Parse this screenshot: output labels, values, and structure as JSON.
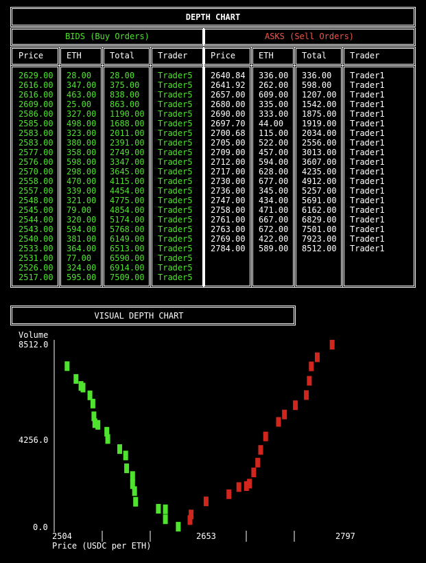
{
  "title": "DEPTH CHART",
  "bids_title": "BIDS (Buy Orders)",
  "asks_title": "ASKS (Sell Orders)",
  "columns": [
    "Price",
    "ETH",
    "Total",
    "Trader"
  ],
  "bids": [
    [
      "2629.00",
      "28.00",
      "28.00",
      "Trader5"
    ],
    [
      "2616.00",
      "347.00",
      "375.00",
      "Trader5"
    ],
    [
      "2616.00",
      "463.00",
      "838.00",
      "Trader5"
    ],
    [
      "2609.00",
      "25.00",
      "863.00",
      "Trader5"
    ],
    [
      "2586.00",
      "327.00",
      "1190.00",
      "Trader5"
    ],
    [
      "2585.00",
      "498.00",
      "1688.00",
      "Trader5"
    ],
    [
      "2583.00",
      "323.00",
      "2011.00",
      "Trader5"
    ],
    [
      "2583.00",
      "380.00",
      "2391.00",
      "Trader5"
    ],
    [
      "2577.00",
      "358.00",
      "2749.00",
      "Trader5"
    ],
    [
      "2576.00",
      "598.00",
      "3347.00",
      "Trader5"
    ],
    [
      "2570.00",
      "298.00",
      "3645.00",
      "Trader5"
    ],
    [
      "2558.00",
      "470.00",
      "4115.00",
      "Trader5"
    ],
    [
      "2557.00",
      "339.00",
      "4454.00",
      "Trader5"
    ],
    [
      "2548.00",
      "321.00",
      "4775.00",
      "Trader5"
    ],
    [
      "2545.00",
      "79.00",
      "4854.00",
      "Trader5"
    ],
    [
      "2544.00",
      "320.00",
      "5174.00",
      "Trader5"
    ],
    [
      "2543.00",
      "594.00",
      "5768.00",
      "Trader5"
    ],
    [
      "2540.00",
      "381.00",
      "6149.00",
      "Trader5"
    ],
    [
      "2533.00",
      "364.00",
      "6513.00",
      "Trader5"
    ],
    [
      "2531.00",
      "77.00",
      "6590.00",
      "Trader5"
    ],
    [
      "2526.00",
      "324.00",
      "6914.00",
      "Trader5"
    ],
    [
      "2517.00",
      "595.00",
      "7509.00",
      "Trader5"
    ]
  ],
  "asks": [
    [
      "2640.84",
      "336.00",
      "336.00",
      "Trader1"
    ],
    [
      "2641.92",
      "262.00",
      "598.00",
      "Trader1"
    ],
    [
      "2657.00",
      "609.00",
      "1207.00",
      "Trader1"
    ],
    [
      "2680.00",
      "335.00",
      "1542.00",
      "Trader1"
    ],
    [
      "2690.00",
      "333.00",
      "1875.00",
      "Trader1"
    ],
    [
      "2697.70",
      "44.00",
      "1919.00",
      "Trader1"
    ],
    [
      "2700.68",
      "115.00",
      "2034.00",
      "Trader1"
    ],
    [
      "2705.00",
      "522.00",
      "2556.00",
      "Trader1"
    ],
    [
      "2709.00",
      "457.00",
      "3013.00",
      "Trader1"
    ],
    [
      "2712.00",
      "594.00",
      "3607.00",
      "Trader1"
    ],
    [
      "2717.00",
      "628.00",
      "4235.00",
      "Trader1"
    ],
    [
      "2730.00",
      "677.00",
      "4912.00",
      "Trader1"
    ],
    [
      "2736.00",
      "345.00",
      "5257.00",
      "Trader1"
    ],
    [
      "2747.00",
      "434.00",
      "5691.00",
      "Trader1"
    ],
    [
      "2758.00",
      "471.00",
      "6162.00",
      "Trader1"
    ],
    [
      "2761.00",
      "667.00",
      "6829.00",
      "Trader1"
    ],
    [
      "2763.00",
      "672.00",
      "7501.00",
      "Trader1"
    ],
    [
      "2769.00",
      "422.00",
      "7923.00",
      "Trader1"
    ],
    [
      "2784.00",
      "589.00",
      "8512.00",
      "Trader1"
    ]
  ],
  "visual_title": "VISUAL DEPTH CHART",
  "chart": {
    "ylabel": "Volume",
    "y_ticks": [
      "8512.0",
      "4256.0",
      "0.0"
    ],
    "x_ticks": [
      "2504",
      "2653",
      "2797"
    ],
    "xlabel": "Price (USDC per ETH)"
  },
  "chart_data": {
    "type": "scatter",
    "xlim": [
      2504,
      2797
    ],
    "ylim": [
      0,
      8512
    ],
    "colors": {
      "bids": "#4fe32f",
      "asks": "#d0261d"
    }
  }
}
